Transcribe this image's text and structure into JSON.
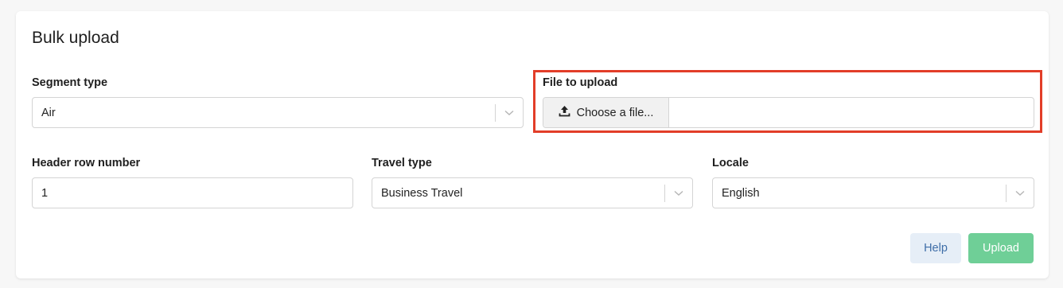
{
  "panel": {
    "title": "Bulk upload"
  },
  "segment_type": {
    "label": "Segment type",
    "value": "Air"
  },
  "file_upload": {
    "label": "File to upload",
    "button_label": "Choose a file...",
    "filename": "",
    "highlight_color": "#e23d28"
  },
  "header_row": {
    "label": "Header row number",
    "value": "1"
  },
  "travel_type": {
    "label": "Travel type",
    "value": "Business Travel"
  },
  "locale": {
    "label": "Locale",
    "value": "English"
  },
  "actions": {
    "help_label": "Help",
    "upload_label": "Upload",
    "upload_color": "#6fcf97",
    "help_color": "#e6eef7"
  },
  "icons": {
    "upload": "upload-icon",
    "chevron": "chevron-down-icon"
  }
}
